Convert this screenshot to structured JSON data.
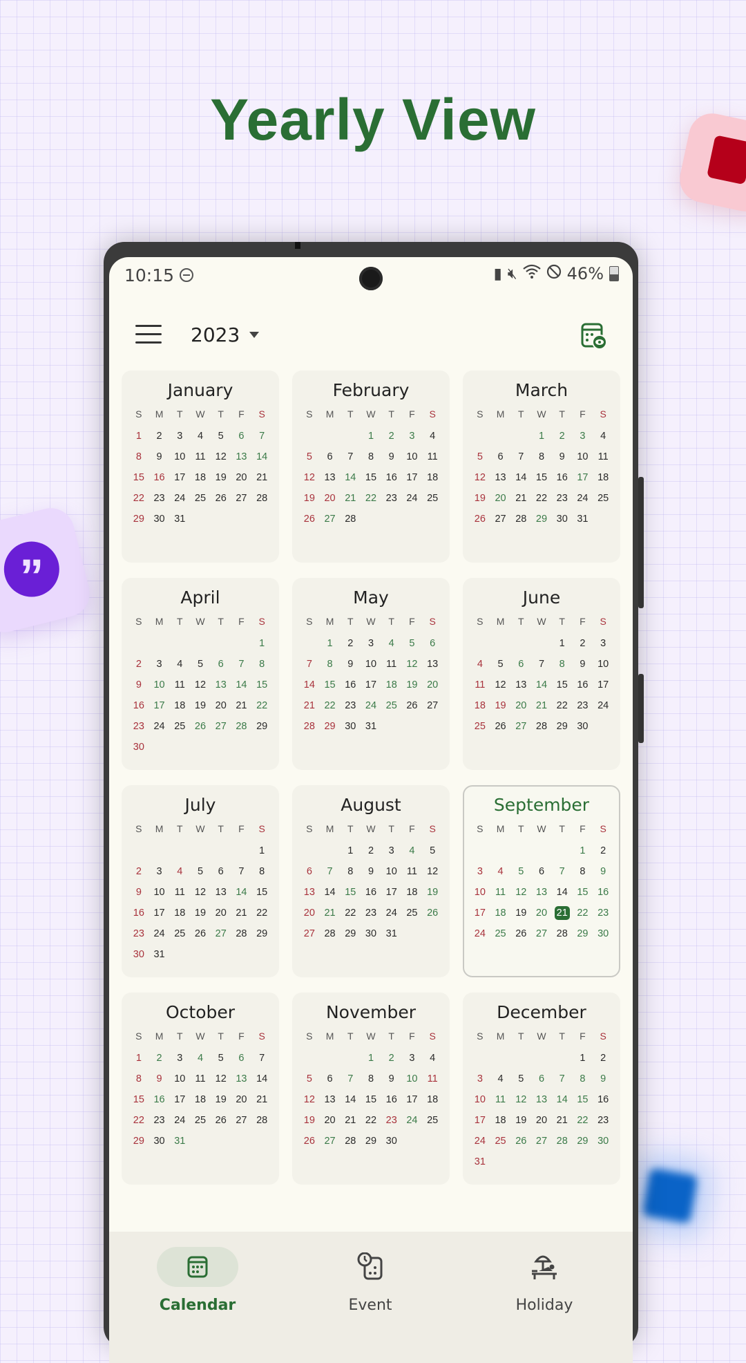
{
  "headline": "Yearly View",
  "status_bar": {
    "time": "10:15",
    "battery": "46%",
    "icons": [
      "do-not-disturb-icon",
      "battery-saver-icon",
      "mute-vibrate-icon",
      "wifi-icon",
      "blocked-icon",
      "battery-icon"
    ]
  },
  "app_bar": {
    "menu_icon": "hamburger-menu-icon",
    "year": "2023",
    "view_icon": "calendar-eye-icon"
  },
  "weekday_labels": [
    "S",
    "M",
    "T",
    "W",
    "T",
    "F",
    "S"
  ],
  "colors": {
    "accent_green": "#2a6e34",
    "holiday_red": "#a8323c",
    "event_green": "#3a7a48"
  },
  "today": {
    "month": "September",
    "day": 21
  },
  "months": [
    {
      "name": "January",
      "start": 0,
      "days": 31,
      "green": [
        6,
        7,
        13,
        14
      ],
      "red": [
        1,
        8,
        15,
        16,
        22,
        29
      ]
    },
    {
      "name": "February",
      "start": 3,
      "days": 28,
      "green": [
        1,
        2,
        3,
        14,
        21,
        22,
        27
      ],
      "red": [
        5,
        12,
        19,
        20,
        26
      ]
    },
    {
      "name": "March",
      "start": 3,
      "days": 31,
      "green": [
        1,
        2,
        3,
        17,
        20,
        29
      ],
      "red": [
        5,
        12,
        19,
        26
      ]
    },
    {
      "name": "April",
      "start": 6,
      "days": 30,
      "green": [
        1,
        6,
        7,
        8,
        10,
        13,
        14,
        15,
        17,
        22,
        26,
        27,
        28
      ],
      "red": [
        2,
        9,
        16,
        23,
        30
      ]
    },
    {
      "name": "May",
      "start": 1,
      "days": 31,
      "green": [
        1,
        4,
        5,
        6,
        8,
        12,
        15,
        18,
        19,
        20,
        22,
        24,
        25
      ],
      "red": [
        7,
        14,
        21,
        28,
        29
      ]
    },
    {
      "name": "June",
      "start": 4,
      "days": 30,
      "green": [
        6,
        8,
        14,
        20,
        21,
        27
      ],
      "red": [
        4,
        11,
        18,
        19,
        25
      ]
    },
    {
      "name": "July",
      "start": 6,
      "days": 31,
      "green": [
        14,
        27
      ],
      "red": [
        2,
        4,
        9,
        16,
        23,
        30
      ]
    },
    {
      "name": "August",
      "start": 2,
      "days": 31,
      "green": [
        4,
        7,
        15,
        19,
        21,
        26
      ],
      "red": [
        6,
        13,
        20,
        27
      ]
    },
    {
      "name": "September",
      "start": 5,
      "days": 30,
      "green": [
        1,
        5,
        7,
        9,
        11,
        12,
        13,
        15,
        16,
        18,
        20,
        22,
        23,
        25,
        27,
        29,
        30
      ],
      "red": [
        3,
        4,
        10,
        17,
        24
      ]
    },
    {
      "name": "October",
      "start": 0,
      "days": 31,
      "green": [
        2,
        4,
        6,
        13,
        16,
        31
      ],
      "red": [
        1,
        8,
        9,
        15,
        22,
        29
      ]
    },
    {
      "name": "November",
      "start": 3,
      "days": 30,
      "green": [
        1,
        2,
        7,
        10,
        24,
        27
      ],
      "red": [
        5,
        11,
        12,
        19,
        23,
        26
      ]
    },
    {
      "name": "December",
      "start": 5,
      "days": 31,
      "green": [
        6,
        7,
        8,
        9,
        11,
        12,
        13,
        14,
        15,
        22,
        26,
        27,
        28,
        29,
        30
      ],
      "red": [
        3,
        10,
        17,
        24,
        25,
        31
      ]
    }
  ],
  "bottom_nav": [
    {
      "label": "Calendar",
      "icon": "calendar-icon",
      "active": true
    },
    {
      "label": "Event",
      "icon": "event-clock-icon",
      "active": false
    },
    {
      "label": "Holiday",
      "icon": "beach-umbrella-icon",
      "active": false
    }
  ]
}
